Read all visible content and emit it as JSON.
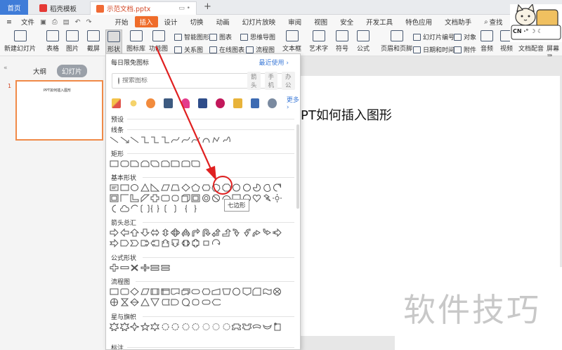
{
  "titlebar": {
    "home_tab": "首页",
    "template_tab": "稻壳模板",
    "doc_tab": "示范文档.pptx",
    "doc_tab_ctrls": "▭ •",
    "add_tab": "+"
  },
  "menubar": {
    "file": "文件",
    "items": [
      "开始",
      "插入",
      "设计",
      "切换",
      "动画",
      "幻灯片放映",
      "审阅",
      "视图",
      "安全",
      "开发工具",
      "特色应用",
      "文档助手"
    ],
    "active": "插入",
    "search": "查找"
  },
  "ribbon": {
    "new_slide": "新建幻灯片",
    "table": "表格",
    "picture": "图片",
    "screenshot": "截屏",
    "shape": "形状",
    "icon_lib": "图标库",
    "function_chart": "功能图",
    "smart_graphic": "智能图形",
    "chart": "图表",
    "mindmap": "思维导图",
    "relation": "关系图",
    "online_chart": "在线图表",
    "flowchart": "流程图",
    "textbox": "文本框",
    "art_text": "艺术字",
    "symbol": "符号",
    "formula": "公式",
    "header_footer": "页眉和页脚",
    "slide_number": "幻灯片编号",
    "object": "对象",
    "datetime": "日期和时间",
    "attachment": "附件",
    "audio": "音频",
    "video": "视频",
    "doc_voice": "文档配音",
    "screen_rec": "屏幕录"
  },
  "left_panel": {
    "tab_outline": "大纲",
    "tab_slides": "幻灯片",
    "slide_number": "1",
    "thumb_title": "PPT如何插入图形"
  },
  "slide": {
    "title": "PT如何插入图形"
  },
  "watermark": "软件技巧",
  "sticker": {
    "cn": "CN ·° ☽ ☾"
  },
  "dropdown": {
    "header": "每日限免图标",
    "recent": "最近使用 ›",
    "search_placeholder": "搜索图标",
    "tags": [
      "箭头",
      "手机",
      "办公"
    ],
    "more": "更多 ›",
    "sections": {
      "preset": "预设",
      "lines": "线条",
      "rect": "矩形",
      "basic": "基本形状",
      "arrows": "箭头总汇",
      "formula": "公式形状",
      "flowchart": "流程图",
      "stars": "星与旗帜",
      "callouts": "标注"
    },
    "tooltip": "七边形"
  },
  "colors": {
    "accent": "#ef6c2a",
    "home_tab": "#3f7cd8",
    "highlight": "#e02020"
  },
  "icons": {
    "daily": [
      "pencil-icon",
      "lightbulb-icon",
      "chat-icon",
      "keyboard-icon",
      "heart-icon",
      "book-icon",
      "badge-icon",
      "bee-icon",
      "document-icon",
      "head-icon"
    ]
  }
}
